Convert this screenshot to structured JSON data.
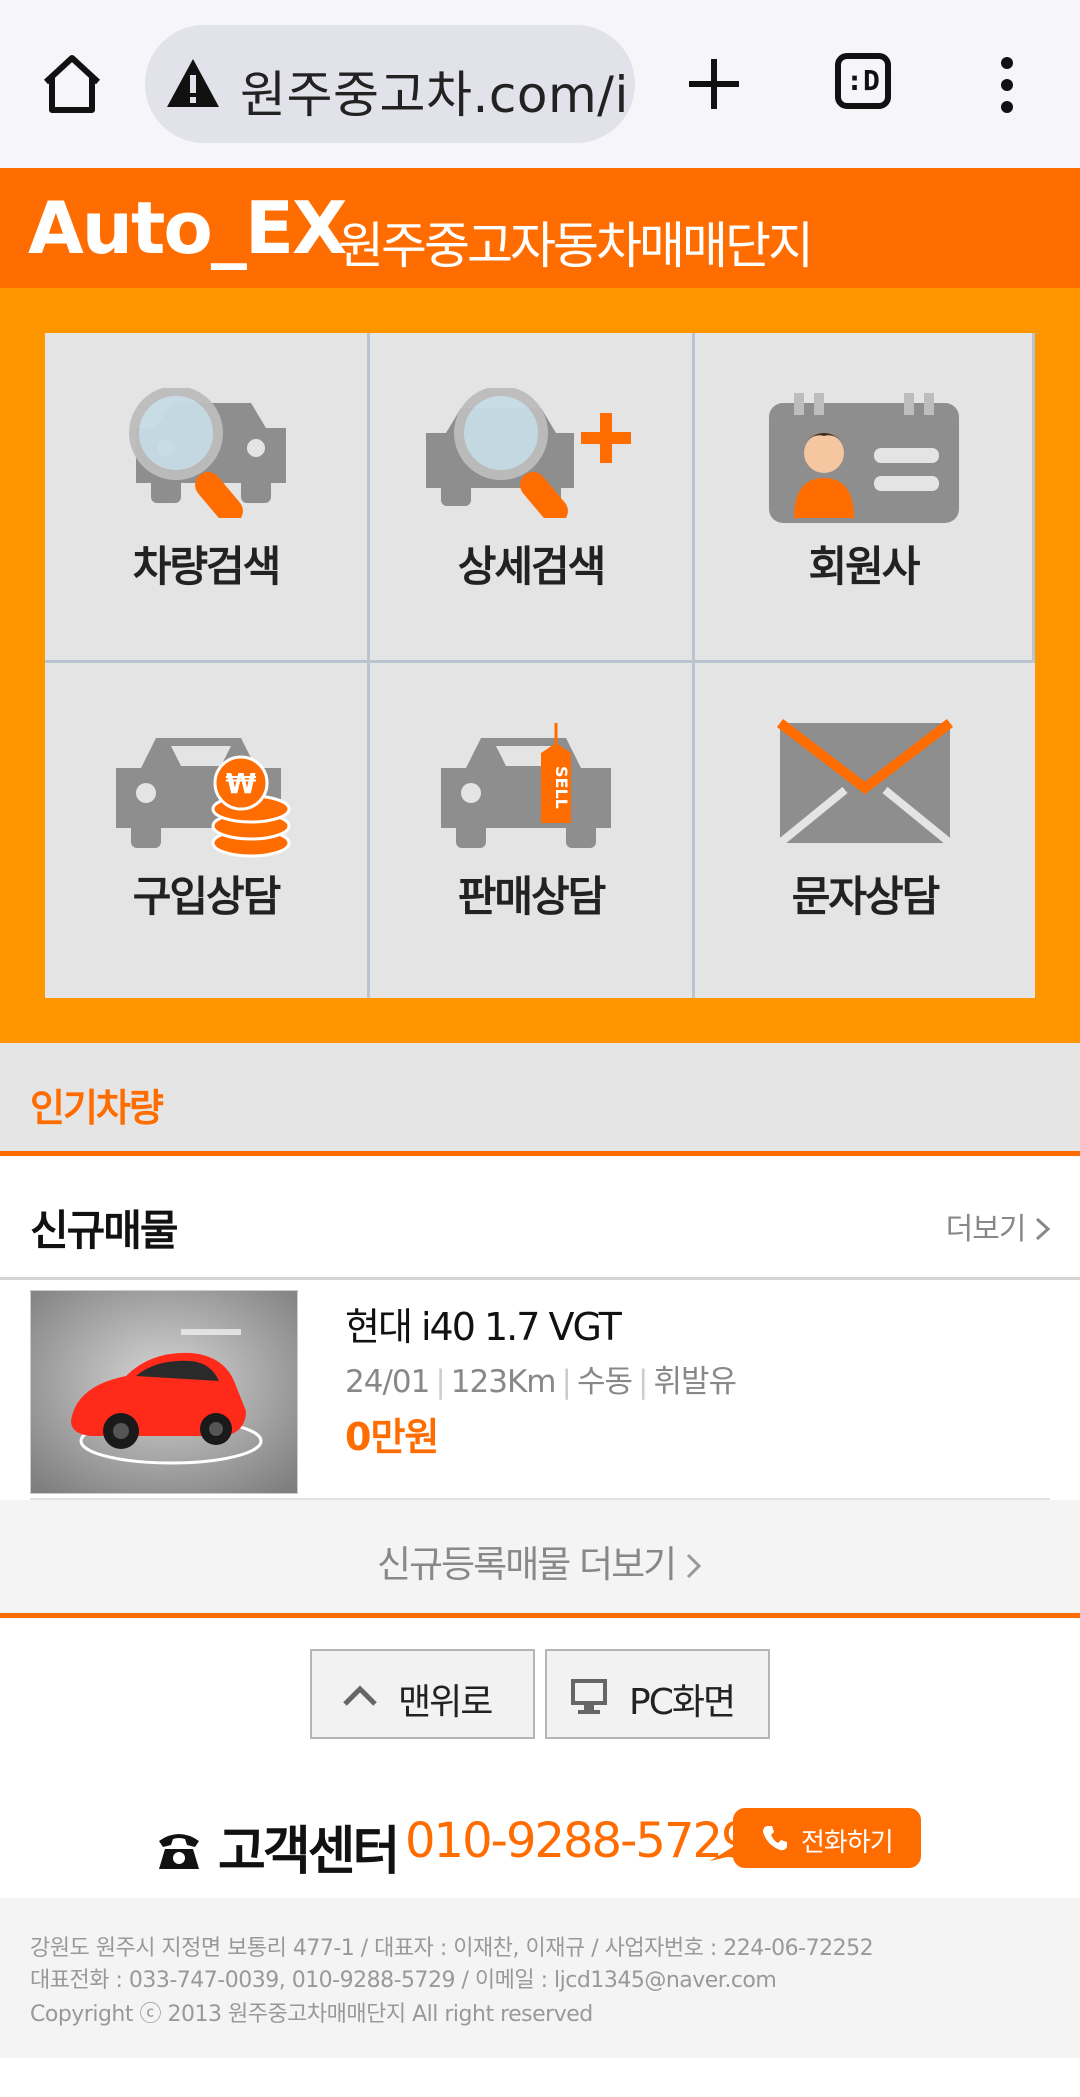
{
  "browser": {
    "url_text": "원주중고차.com/i",
    "tabs_label": ":D"
  },
  "header": {
    "brand_en": "Auto_EX",
    "brand_ko": "원주중고자동차매매단지"
  },
  "menu": {
    "items": [
      {
        "label": "차량검색"
      },
      {
        "label": "상세검색"
      },
      {
        "label": "회원사"
      },
      {
        "label": "구입상담"
      },
      {
        "label": "판매상담"
      },
      {
        "label": "문자상담"
      }
    ],
    "sell_tag": "SELL",
    "won_symbol": "₩"
  },
  "popular": {
    "title": "인기차량"
  },
  "new_listings": {
    "title": "신규매물",
    "more_label": "더보기",
    "items": [
      {
        "name": "현대 i40 1.7 VGT",
        "year": "24/01",
        "mileage": "123Km",
        "transmission": "수동",
        "fuel": "휘발유",
        "price": "0만원"
      }
    ],
    "more_bar_label": "신규등록매물 더보기"
  },
  "buttons": {
    "top_label": "맨위로",
    "pc_label": "PC화면"
  },
  "customer_center": {
    "label": "고객센터",
    "phone": "010-9288-5729",
    "call_label": "전화하기"
  },
  "footer": {
    "line1": "강원도 원주시 지정면 보통리 477-1 / 대표자 : 이재찬, 이재규 / 사업자번호 : 224-06-72252",
    "line2": "대표전화 : 033-747-0039, 010-9288-5729 / 이메일 : ljcd1345@naver.com",
    "line3": "Copyright ⓒ 2013 원주중고차매매단지 All right reserved"
  },
  "colors": {
    "accent": "#ff6c00",
    "menu_bg": "#ff9600",
    "icon_grey": "#8e8e8e"
  }
}
